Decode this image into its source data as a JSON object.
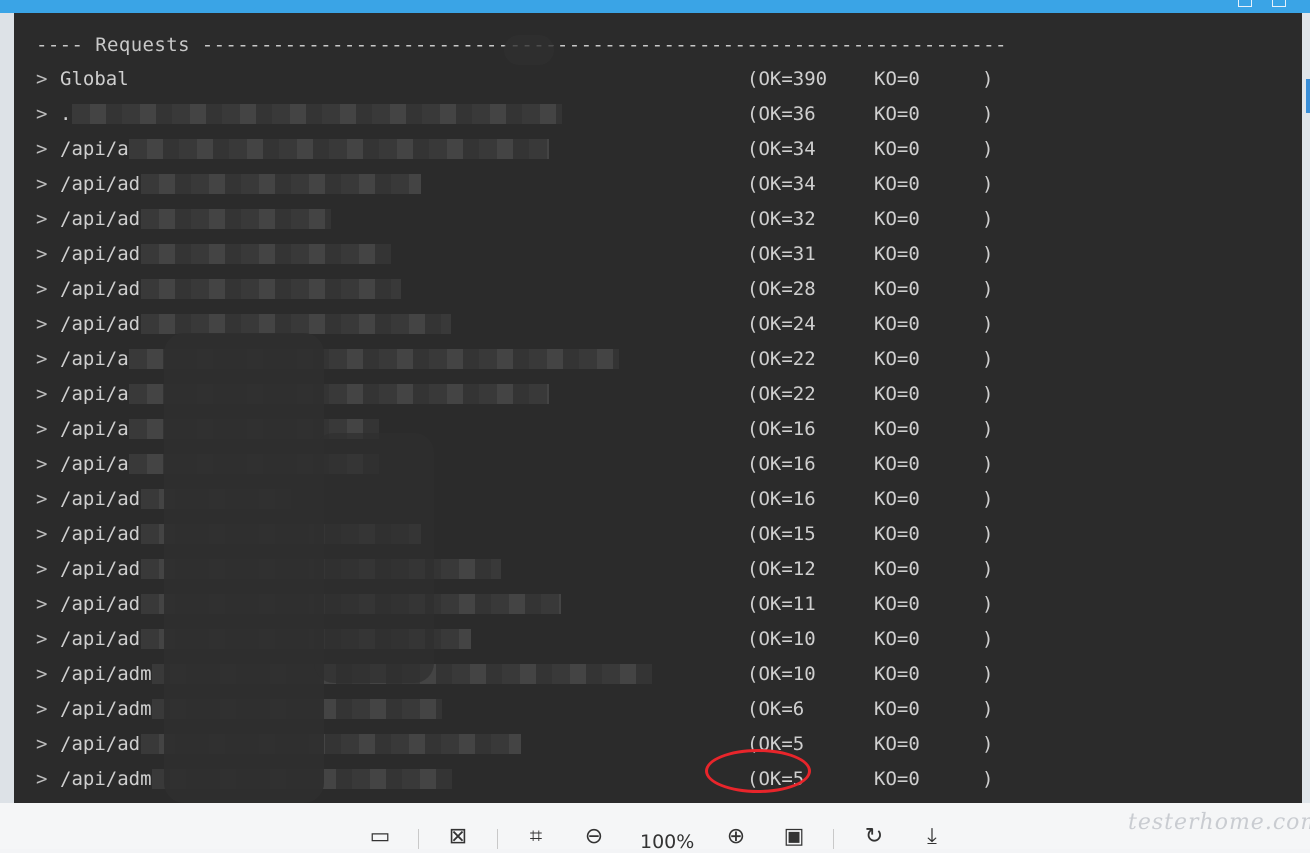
{
  "terminal": {
    "header": "---- Requests --------------------------------------------------------------------",
    "rows": [
      {
        "label": "Global",
        "ok": "(OK=390",
        "ko": "KO=0",
        "close": ")"
      },
      {
        "label": ".",
        "ok": "(OK=36",
        "ko": "KO=0",
        "close": ")"
      },
      {
        "label": "/api/a",
        "ok": "(OK=34",
        "ko": "KO=0",
        "close": ")"
      },
      {
        "label": "/api/ad",
        "ok": "(OK=34",
        "ko": "KO=0",
        "close": ")"
      },
      {
        "label": "/api/ad",
        "ok": "(OK=32",
        "ko": "KO=0",
        "close": ")"
      },
      {
        "label": "/api/ad",
        "ok": "(OK=31",
        "ko": "KO=0",
        "close": ")"
      },
      {
        "label": "/api/ad",
        "ok": "(OK=28",
        "ko": "KO=0",
        "close": ")"
      },
      {
        "label": "/api/ad",
        "ok": "(OK=24",
        "ko": "KO=0",
        "close": ")"
      },
      {
        "label": "/api/a",
        "ok": "(OK=22",
        "ko": "KO=0",
        "close": ")"
      },
      {
        "label": "/api/a",
        "ok": "(OK=22",
        "ko": "KO=0",
        "close": ")"
      },
      {
        "label": "/api/a",
        "ok": "(OK=16",
        "ko": "KO=0",
        "close": ")"
      },
      {
        "label": "/api/a",
        "ok": "(OK=16",
        "ko": "KO=0",
        "close": ")"
      },
      {
        "label": "/api/ad",
        "ok": "(OK=16",
        "ko": "KO=0",
        "close": ")"
      },
      {
        "label": "/api/ad",
        "ok": "(OK=15",
        "ko": "KO=0",
        "close": ")"
      },
      {
        "label": "/api/ad",
        "ok": "(OK=12",
        "ko": "KO=0",
        "close": ")"
      },
      {
        "label": "/api/ad",
        "ok": "(OK=11",
        "ko": "KO=0",
        "close": ")"
      },
      {
        "label": "/api/ad",
        "ok": "(OK=10",
        "ko": "KO=0",
        "close": ")"
      },
      {
        "label": "/api/adm",
        "ok": "(OK=10",
        "ko": "KO=0",
        "close": ")"
      },
      {
        "label": "/api/adm",
        "ok": "(OK=6",
        "ko": "KO=0",
        "close": ")"
      },
      {
        "label": "/api/ad",
        "ok": "(OK=5",
        "ko": "KO=0",
        "close": ")"
      },
      {
        "label": "/api/adm",
        "ok": "(OK=5",
        "ko": "KO=0",
        "close": ")"
      }
    ]
  },
  "toolbar": {
    "zoom": "100%",
    "icons": [
      "screen-icon",
      "fit-width-icon",
      "fit-page-icon",
      "zoom-out-icon",
      "zoom-in-icon",
      "actual-size-icon",
      "rotate-icon",
      "download-icon"
    ]
  },
  "watermark": "testerhome.com",
  "colors": {
    "terminal_bg": "#2b2b2b",
    "terminal_text": "#cfcfcf",
    "annotation": "#e8252b",
    "title_bar": "#3aa4e6"
  }
}
